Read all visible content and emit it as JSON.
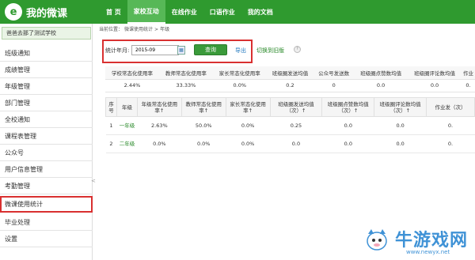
{
  "app": {
    "logo_mark": "e",
    "title": "我的微课"
  },
  "topnav": [
    {
      "label": "首  页",
      "active": false
    },
    {
      "label": "家校互动",
      "active": true
    },
    {
      "label": "在线作业",
      "active": false
    },
    {
      "label": "口语作业",
      "active": false
    },
    {
      "label": "我的文档",
      "active": false
    }
  ],
  "sidebar": {
    "school": "爸爸去那了测试学校",
    "items": [
      "班级通知",
      "成绩管理",
      "年级管理",
      "部门管理",
      "全校通知",
      "课程表管理",
      "公众号",
      "用户信息管理",
      "考勤管理",
      "微课使用统计",
      "毕业处理",
      "设置"
    ],
    "highlighted_index": 9,
    "collapse_glyph": "<"
  },
  "breadcrumb": {
    "prefix": "当前位置：",
    "path": [
      "微课使用统计",
      ">",
      "年级"
    ]
  },
  "filter": {
    "label": "统计年月:",
    "month_value": "2015-09",
    "query_label": "查询",
    "export_label": "导出",
    "old_version_label": "切换到旧版",
    "help_glyph": "?"
  },
  "summary": {
    "headers": [
      "学校常态化使用率",
      "教师常态化使用率",
      "家长常态化使用率",
      "班级圈发送均值",
      "公众号发送数",
      "班级圈点赞数均值",
      "班级圈评论数均值",
      "作业"
    ],
    "values": [
      "2.44%",
      "33.33%",
      "0.0%",
      "0.2",
      "0",
      "0.0",
      "0.0",
      "0."
    ]
  },
  "detail": {
    "headers": [
      "序号",
      "年级",
      "年级常态化使用率↑",
      "教师常态化使用率↑",
      "家长常态化使用率↑",
      "班级圈发送均值（次）↑",
      "班级圈点赞数均值（次）↑",
      "班级圈评论数均值（次）↑",
      "作业发（次）"
    ],
    "rows": [
      {
        "index": "1",
        "grade": "一年级",
        "grade_rate": "2.63%",
        "teacher_rate": "50.0%",
        "parent_rate": "0.0%",
        "circle_send": "0.25",
        "likes": "0.0",
        "comments": "0.0",
        "homework": "0."
      },
      {
        "index": "2",
        "grade": "二年级",
        "grade_rate": "0.0%",
        "teacher_rate": "0.0%",
        "parent_rate": "0.0%",
        "circle_send": "0.0",
        "likes": "0.0",
        "comments": "0.0",
        "homework": "0."
      }
    ]
  },
  "watermark": {
    "text": "牛游戏网",
    "url": "www.newyx.net"
  },
  "colors": {
    "brand_green": "#2f9a2f",
    "highlight_red": "#d93030",
    "link_blue": "#2a7ec1"
  }
}
